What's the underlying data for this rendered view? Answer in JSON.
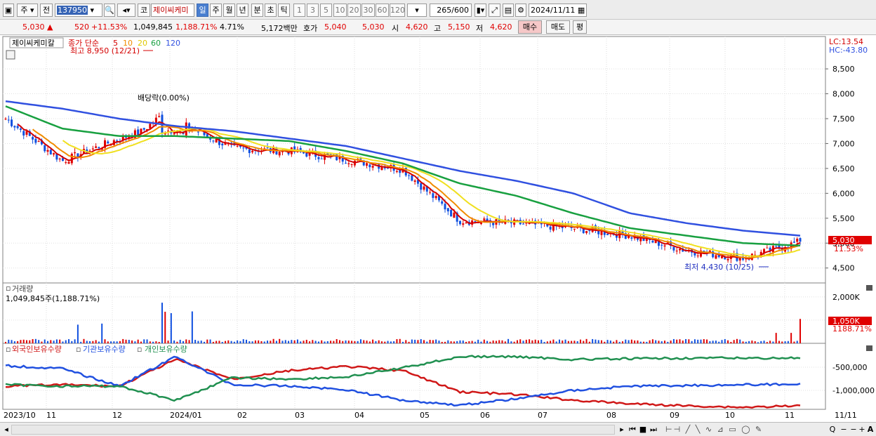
{
  "toolbar": {
    "type_select": "주",
    "prev_label": "전",
    "code": "137950",
    "market": "코",
    "stock_name": "제이씨케미",
    "periods": [
      "일",
      "주",
      "월",
      "년",
      "분",
      "초",
      "틱"
    ],
    "intervals": [
      "1",
      "3",
      "5",
      "10",
      "20",
      "30",
      "60",
      "120"
    ],
    "count": "265",
    "count_total": "/600",
    "date": "2024/11/11"
  },
  "quote": {
    "price": "5,030",
    "change": "520",
    "change_pct": "+11.53%",
    "volume": "1,049,845",
    "volume_ratio": "1,188.71%",
    "turnover": "4.71%",
    "amount": "5,172백만",
    "ask_label": "호가",
    "ask_bid": "5,040",
    "ask_ask": "5,030",
    "open_label": "시",
    "open": "4,620",
    "high_label": "고",
    "high": "5,150",
    "low_label": "저",
    "low": "4,620",
    "buy_label": "매수",
    "sell_label": "매도",
    "avg_label": "평"
  },
  "price_panel": {
    "stock_label": "제이씨케미칼",
    "legend_prefix": "종가 단순",
    "ma_labels": [
      "5",
      "10",
      "20",
      "60",
      "120"
    ],
    "ma_colors": [
      "#d40000",
      "#f08c00",
      "#f0e020",
      "#18a040",
      "#3050e0"
    ],
    "lc_label": "LC:13.54",
    "hc_label": "HC:-43.80",
    "max_annotation": "최고 8,950 (12/21)",
    "min_annotation": "최저 4,430 (10/25)",
    "dividend_annotation": "배당락(0.00%)",
    "current_price_tag": "5,030",
    "current_pct_tag": "11.53%"
  },
  "volume_panel": {
    "title": "거래량",
    "subtitle": "1,049,845주(1,188.71%)",
    "current_tag": "1,050K",
    "current_pct": "1188.71%"
  },
  "holding_panel": {
    "legend": [
      "외국인보유수량",
      "기관보유수량",
      "개인보유수량"
    ],
    "colors": [
      "#d01818",
      "#2050e0",
      "#209050"
    ]
  },
  "x_axis": [
    "2023/10",
    "11",
    "12",
    "2024/01",
    "02",
    "03",
    "04",
    "05",
    "06",
    "07",
    "08",
    "09",
    "10",
    "11",
    "11/11"
  ],
  "chart_data": [
    {
      "type": "candlestick",
      "title": "제이씨케미칼",
      "ylim": [
        4200,
        9150
      ],
      "y_ticks": [
        "8,500",
        "8,000",
        "7,500",
        "7,000",
        "6,500",
        "6,000",
        "5,500",
        "5,000",
        "4,500"
      ],
      "series_approx": {
        "x": [
          "2023/10",
          "11",
          "12",
          "2024/01",
          "02",
          "03",
          "04",
          "05",
          "06",
          "07",
          "08",
          "09",
          "10",
          "11",
          "11/11"
        ],
        "close": [
          7500,
          6650,
          7100,
          7450,
          6900,
          6850,
          6680,
          6480,
          5450,
          5400,
          5300,
          5150,
          4850,
          4700,
          5030
        ]
      },
      "ma120": [
        7850,
        7700,
        7500,
        7350,
        7250,
        7100,
        6950,
        6700,
        6450,
        6250,
        6000,
        5600,
        5400,
        5250,
        5150
      ],
      "ma60": [
        7750,
        7300,
        7150,
        7150,
        7100,
        7050,
        6850,
        6600,
        6200,
        5950,
        5600,
        5300,
        5150,
        5000,
        4950
      ]
    },
    {
      "type": "bar",
      "title": "거래량",
      "y_ticks": [
        "2,000K",
        "1,000K"
      ],
      "ylim": [
        0,
        2600
      ]
    },
    {
      "type": "line",
      "title": "외국인보유수량 / 기관보유수량 / 개인보유수량",
      "y_ticks": [
        "-500,000",
        "-1,000,000"
      ]
    }
  ]
}
